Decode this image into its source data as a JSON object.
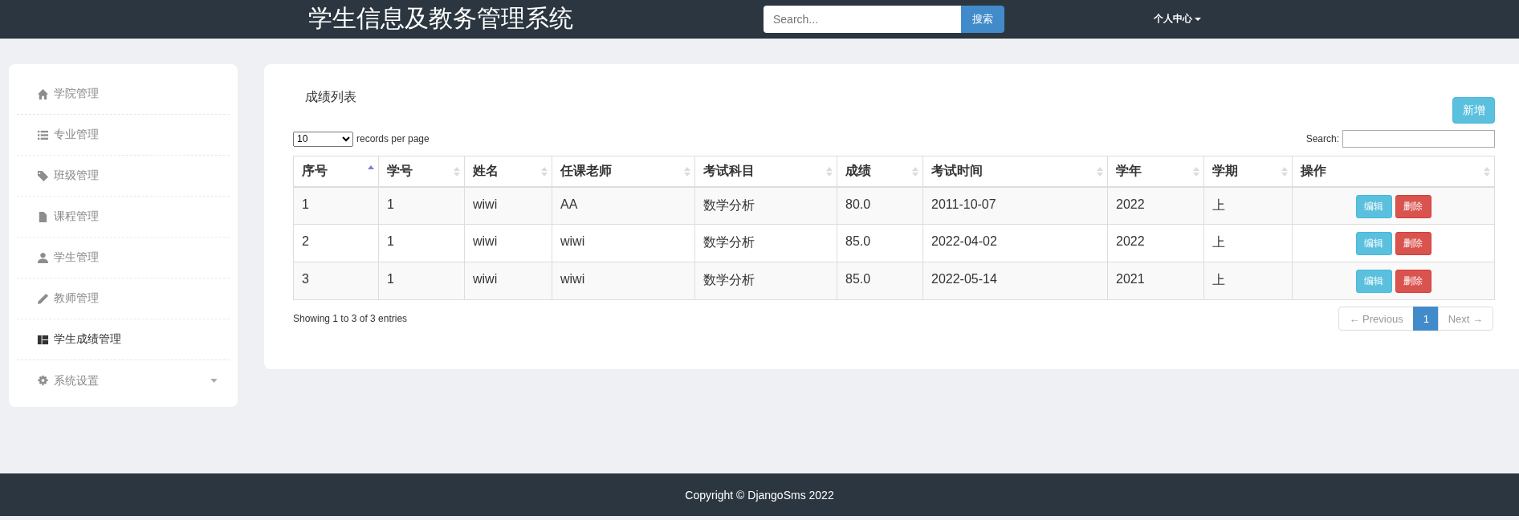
{
  "header": {
    "title": "学生信息及教务管理系统",
    "search": {
      "placeholder": "Search..."
    },
    "search_button": "搜索",
    "user_menu": "个人中心"
  },
  "sidebar": {
    "items": [
      {
        "label": "学院管理",
        "selected": false,
        "kind": "link"
      },
      {
        "label": "专业管理",
        "selected": false,
        "kind": "link"
      },
      {
        "label": "班级管理",
        "selected": false,
        "kind": "link"
      },
      {
        "label": "课程管理",
        "selected": false,
        "kind": "link"
      },
      {
        "label": "学生管理",
        "selected": false,
        "kind": "link"
      },
      {
        "label": "教师管理",
        "selected": false,
        "kind": "link"
      },
      {
        "label": "学生成绩管理",
        "selected": true,
        "kind": "link"
      },
      {
        "label": "系统设置",
        "selected": false,
        "kind": "dropdown"
      }
    ]
  },
  "panel": {
    "title": "成绩列表",
    "add_button": "新增",
    "page_size": "10",
    "page_size_label": "records per page",
    "search_label": "Search:",
    "table": {
      "columns": [
        {
          "label": "序号",
          "sorted": true
        },
        {
          "label": "学号",
          "sorted": false
        },
        {
          "label": "姓名",
          "sorted": false
        },
        {
          "label": "任课老师",
          "sorted": false
        },
        {
          "label": "考试科目",
          "sorted": false
        },
        {
          "label": "成绩",
          "sorted": false
        },
        {
          "label": "考试时间",
          "sorted": false
        },
        {
          "label": "学年",
          "sorted": false
        },
        {
          "label": "学期",
          "sorted": false
        },
        {
          "label": "操作",
          "sorted": false
        }
      ],
      "rows": [
        {
          "cells": [
            "1",
            "1",
            "wiwi",
            "AA",
            "数学分析",
            "80.0",
            "2011-10-07",
            "2022",
            "上"
          ],
          "actions": [
            "编辑",
            "删除"
          ]
        },
        {
          "cells": [
            "2",
            "1",
            "wiwi",
            "wiwi",
            "数学分析",
            "85.0",
            "2022-04-02",
            "2022",
            "上"
          ],
          "actions": [
            "编辑",
            "删除"
          ]
        },
        {
          "cells": [
            "3",
            "1",
            "wiwi",
            "wiwi",
            "数学分析",
            "85.0",
            "2022-05-14",
            "2021",
            "上"
          ],
          "actions": [
            "编辑",
            "删除"
          ]
        }
      ]
    },
    "info": "Showing 1 to 3 of 3 entries",
    "pagination": [
      {
        "label": "← Previous",
        "disabled": true,
        "selected": false
      },
      {
        "label": "1",
        "disabled": false,
        "selected": true
      },
      {
        "label": "Next →",
        "disabled": true,
        "selected": false
      }
    ]
  },
  "footer": "Copyright © DjangoSms 2022"
}
